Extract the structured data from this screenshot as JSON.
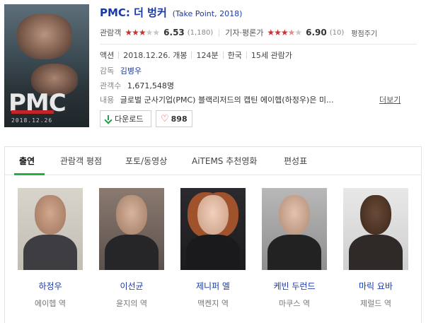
{
  "movie": {
    "title": "PMC: 더 벙커",
    "subtitle": "(Take Point, 2018)",
    "poster_title": "PMC",
    "poster_date": "2018.12.26",
    "audience_rating": {
      "label": "관람객",
      "stars_filled": "★★★",
      "stars_empty": "★★",
      "score": "6.53",
      "count": "(1,180)"
    },
    "critic_rating": {
      "label": "기자·평론가",
      "stars_filled": "★★★",
      "stars_half": "★",
      "stars_empty": "★",
      "score": "6.90",
      "count": "(10)"
    },
    "critic_more": "평점주기",
    "meta": [
      "액션",
      "2018.12.26. 개봉",
      "124분",
      "한국",
      "15세 관람가"
    ],
    "director_label": "감독",
    "director": "김병우",
    "audience_label": "관객수",
    "audience": "1,671,548명",
    "desc_label": "내용",
    "description": "글로벌 군사기업(PMC) 블랙리저드의 캡틴 에이헵(하정우)은 미...",
    "more_label": "더보기",
    "download_label": "다운로드",
    "like_count": "898"
  },
  "tabs": [
    "출연",
    "관람객 평점",
    "포토/동영상",
    "AiTEMS 추천영화",
    "편성표"
  ],
  "cast": [
    {
      "name": "하정우",
      "role": "에이헵 역"
    },
    {
      "name": "이선균",
      "role": "윤지의 역"
    },
    {
      "name": "제니퍼 엘",
      "role": "맥켄지 역"
    },
    {
      "name": "케빈 두런드",
      "role": "마쿠스 역"
    },
    {
      "name": "마릭 요바",
      "role": "제럴드 역"
    }
  ],
  "colors": {
    "accent_green": "#22b046",
    "link_blue": "#1a3aa8",
    "star_red": "#cf2f2f"
  }
}
